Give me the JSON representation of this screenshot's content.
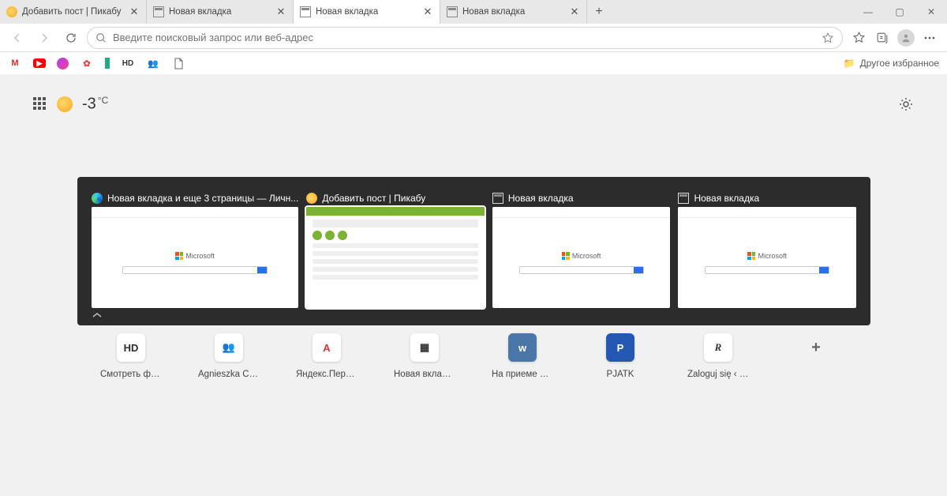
{
  "tabs": [
    {
      "label": "Добавить пост | Пикабу",
      "favicon": "pikabu"
    },
    {
      "label": "Новая вкладка",
      "favicon": "newtab"
    },
    {
      "label": "Новая вкладка",
      "favicon": "newtab",
      "active": true
    },
    {
      "label": "Новая вкладка",
      "favicon": "newtab"
    }
  ],
  "window_controls": {
    "minimize": "—",
    "maximize": "▢",
    "close": "✕"
  },
  "toolbar": {
    "search_placeholder": "Введите поисковый запрос или веб-адрес"
  },
  "bookmarks_right": {
    "label": "Другое избранное"
  },
  "ntp": {
    "temperature": "-3",
    "temperature_unit": "°C"
  },
  "switcher": {
    "items": [
      {
        "label": "Новая вкладка и еще 3 страницы — Личн...",
        "icon": "edge",
        "kind": "edge"
      },
      {
        "label": "Добавить пост | Пикабу",
        "icon": "pikabu",
        "kind": "pikabu",
        "selected": true
      },
      {
        "label": "Новая вкладка",
        "icon": "newtab",
        "kind": "edge"
      },
      {
        "label": "Новая вкладка",
        "icon": "newtab",
        "kind": "edge"
      }
    ],
    "preview_text": "Microsoft"
  },
  "quicklinks": [
    {
      "label": "Смотреть фи...",
      "icon_text": "HD",
      "icon_bg": "#ffffff",
      "icon_color": "#2c2c2c"
    },
    {
      "label": "Agnieszka Cer...",
      "icon_text": "👥",
      "icon_bg": "#ffffff",
      "icon_color": "#5558af"
    },
    {
      "label": "Яндекс.Пере...",
      "icon_text": "А",
      "icon_bg": "#ffffff",
      "icon_color": "#d63333"
    },
    {
      "label": "Новая вкладка",
      "icon_text": "▦",
      "icon_bg": "#ffffff",
      "icon_color": "#555"
    },
    {
      "label": "На приеме у ...",
      "icon_text": "w",
      "icon_bg": "#4a76a8",
      "icon_color": "#ffffff"
    },
    {
      "label": "PJATK",
      "icon_text": "P",
      "icon_bg": "#2558b3",
      "icon_color": "#ffffff"
    },
    {
      "label": "Zaloguj się ‹ R...",
      "icon_text": "R",
      "icon_bg": "#ffffff",
      "icon_color": "#333"
    }
  ],
  "add_site": "+"
}
